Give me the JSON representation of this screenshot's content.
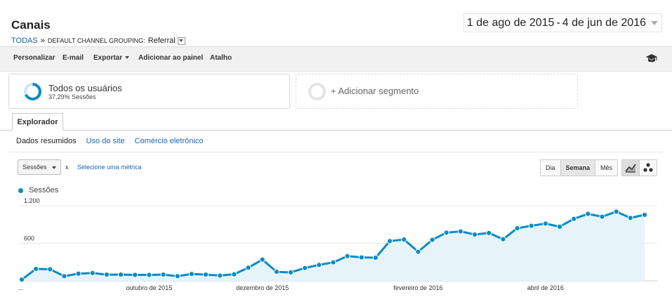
{
  "header": {
    "title": "Canais",
    "breadcrumb": {
      "root": "TODAS",
      "sep": "»",
      "grouping": "DEFAULT CHANNEL GROUPING:",
      "value": "Referral"
    },
    "date_start": "1 de ago de 2015",
    "date_sep": "-",
    "date_end": "4 de jun de 2016"
  },
  "toolbar": {
    "customize": "Personalizar",
    "email": "E-mail",
    "export": "Exportar",
    "add_dashboard": "Adicionar ao painel",
    "shortcut": "Atalho"
  },
  "segments": {
    "active_name": "Todos os usuários",
    "active_pct": "37,29% Sessões",
    "add_label": "+ Adicionar segmento"
  },
  "tabs": {
    "explorer": "Explorador",
    "sub": [
      "Dados resumidos",
      "Uso do site",
      "Comércio eletrônico"
    ]
  },
  "controls": {
    "metric": "Sessões",
    "x": "x",
    "select_metric": "Selecione uma métrica",
    "periods": [
      "Dia",
      "Semana",
      "Mês"
    ],
    "active_period": "Semana"
  },
  "colors": {
    "accent": "#058dc7",
    "fill": "#e6f4fa",
    "link": "#1a65b5"
  },
  "chart_data": {
    "type": "area",
    "series": [
      {
        "name": "Sessões",
        "values": [
          20,
          190,
          185,
          75,
          115,
          125,
          100,
          100,
          95,
          95,
          100,
          75,
          110,
          100,
          85,
          105,
          210,
          340,
          145,
          135,
          205,
          255,
          295,
          395,
          375,
          370,
          635,
          660,
          465,
          655,
          770,
          790,
          740,
          765,
          665,
          840,
          880,
          915,
          865,
          990,
          1070,
          1025,
          1105,
          1005,
          1055
        ]
      }
    ],
    "ytick_labels": [
      "1.200",
      "600"
    ],
    "yticks": [
      1200,
      600
    ],
    "xtick_labels": [
      "...",
      "outubro de 2015",
      "dezembro de 2015",
      "fevereiro de 2016",
      "abril de 2016"
    ],
    "xtick_index": [
      0,
      9,
      17,
      28,
      37
    ],
    "ylim": [
      0,
      1200
    ],
    "grid": true,
    "legend": "top-left"
  }
}
